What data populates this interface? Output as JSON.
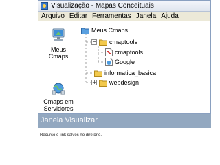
{
  "window": {
    "title": "Visualização - Mapas Conceituais"
  },
  "menu": [
    "Arquivo",
    "Editar",
    "Ferramentas",
    "Janela",
    "Ajuda"
  ],
  "left_nav": [
    {
      "label_line1": "Meus",
      "label_line2": "Cmaps",
      "icon": "computer-icon"
    },
    {
      "label_line1": "Cmaps em",
      "label_line2": "Servidores",
      "icon": "servers-globe-icon"
    }
  ],
  "tree": {
    "root": "Meus Cmaps",
    "items": [
      {
        "label": "cmaptools",
        "icon": "folder-icon",
        "expander": "−"
      },
      {
        "label": "cmaptools",
        "icon": "concept-map-icon"
      },
      {
        "label": "Google",
        "icon": "web-link-icon"
      },
      {
        "label": "informatica_basica",
        "icon": "folder-icon"
      },
      {
        "label": "webdesign",
        "icon": "folder-icon",
        "expander": "+"
      }
    ]
  },
  "slide": {
    "heading": "Janela Visualizar",
    "caption": "Recurso e link salvos no diretório."
  },
  "colors": {
    "accent_bar": "#93a8c0",
    "folder": "#f2c94c"
  }
}
